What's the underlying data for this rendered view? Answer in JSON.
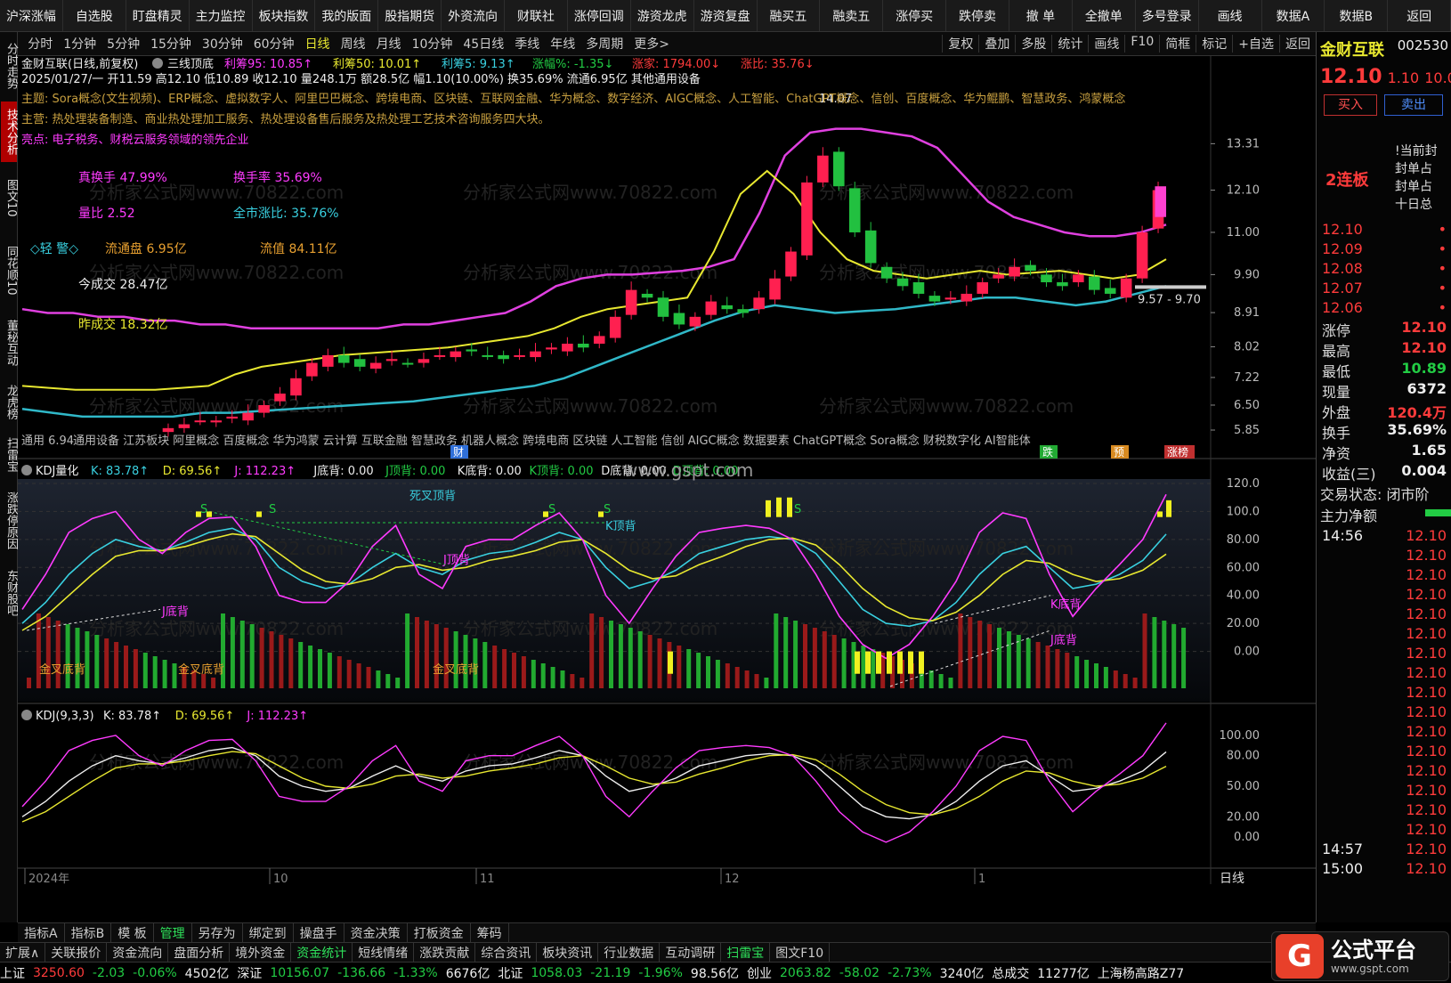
{
  "top_menu": [
    "沪深涨幅",
    "自选股",
    "盯盘精灵",
    "主力监控",
    "板块指数",
    "我的版面",
    "股指期货",
    "外资流向",
    "财联社",
    "涨停回调",
    "游资龙虎",
    "游资复盘",
    "融买五",
    "融卖五",
    "涨停买",
    "跌停卖",
    "撤 单",
    "全撤单",
    "多号登录",
    "画线",
    "数据A",
    "数据B",
    "返回"
  ],
  "period_tabs": [
    "分时",
    "1分钟",
    "5分钟",
    "15分钟",
    "30分钟",
    "60分钟",
    "日线",
    "周线",
    "月线",
    "10分钟",
    "45日线",
    "季线",
    "年线",
    "多周期",
    "更多>"
  ],
  "active_period": "日线",
  "tool_tabs": [
    "复权",
    "叠加",
    "多股",
    "统计",
    "画线",
    "F10",
    "简框",
    "标记",
    "+自选",
    "返回"
  ],
  "left_tabs": [
    "分时走势",
    "技术分析",
    "图文10",
    "同花顺10",
    "董秘互动",
    "龙虎榜",
    "扫雷宝",
    "涨跌停原因",
    "东财股吧"
  ],
  "active_left_tab": "技术分析",
  "header": {
    "stock_title": "金财互联(日线,前复权)",
    "pattern": "三线顶底",
    "chips": [
      {
        "text": "利筹95: 10.85↑",
        "color": "#ff3bff"
      },
      {
        "text": "利筹50: 10.01↑",
        "color": "#e8e830"
      },
      {
        "text": "利筹5: 9.13↑",
        "color": "#39d0e0"
      },
      {
        "text": "涨幅%: -1.35↓",
        "color": "#22cc44"
      },
      {
        "text": "涨家: 1794.00↓",
        "color": "#ff3b3b"
      },
      {
        "text": "涨比: 35.76↓",
        "color": "#ff3b3b"
      }
    ],
    "date_line": "2025/01/27/一 开11.59 高12.10 低10.89 收12.10 量248.1万 额28.5亿 幅1.10(10.00%) 换35.69% 流通6.95亿 其他通用设备",
    "theme": "主题: Sora概念(文生视频)、ERP概念、虚拟数字人、阿里巴巴概念、跨境电商、区块链、互联网金融、华为概念、数字经济、AIGC概念、人工智能、ChatGPT概念、信创、百度概念、华为鲲鹏、智慧政务、鸿蒙概念",
    "business": "主营: 热处理装备制造、商业热处理加工服务、热处理设备售后服务及热处理工艺技术咨询服务四大块。",
    "highlight": "亮点: 电子税务、财税云服务领域的领先企业"
  },
  "info_labels": [
    {
      "text": "真换手 47.99%",
      "color": "#ff3bff"
    },
    {
      "text": "换手率 35.69%",
      "color": "#ff3bff"
    },
    {
      "text": "量比 2.52",
      "color": "#ff3bff"
    },
    {
      "text": "全市涨比: 35.76%",
      "color": "#39d0e0"
    },
    {
      "text": "◇轻 警◇",
      "color": "#39d0e0"
    },
    {
      "text": "流通盘 6.95亿",
      "color": "#e8a030"
    },
    {
      "text": "流值 84.11亿",
      "color": "#e8a030"
    },
    {
      "text": "今成交 28.47亿",
      "color": "#eeeeee"
    },
    {
      "text": "昨成交 18.32亿",
      "color": "#e8e830"
    }
  ],
  "concept_bar": "通用设备 江苏板块 阿里概念 百度概念 华为鸿蒙 云计算 互联金融 智慧政务 机器人概念 跨境电商 区块链 人工智能 信创 AIGC概念 数据要素 ChatGPT概念 Sora概念 财税数字化 AI智能体",
  "concept_prefix": "通用 6.94",
  "main_price_ticks": [
    "13.31",
    "12.10",
    "11.00",
    "9.90",
    "8.91",
    "8.02",
    "7.22",
    "6.50",
    "5.85"
  ],
  "price_annotations": {
    "high": "14.07",
    "range": "9.57 - 9.70"
  },
  "badges": [
    {
      "text": "财",
      "color": "#2f6fd8"
    },
    {
      "text": "跌",
      "color": "#22aa33"
    },
    {
      "text": "预",
      "color": "#d88a20"
    },
    {
      "text": "涨榜",
      "color": "#c03030"
    }
  ],
  "kdj_quant": {
    "title": "KDJ量化",
    "values": [
      {
        "text": "K: 83.78↑",
        "color": "#39d0e0"
      },
      {
        "text": "D: 69.56↑",
        "color": "#e8e830"
      },
      {
        "text": "J: 112.23↑",
        "color": "#ff3bff"
      },
      {
        "text": "J底背: 0.00",
        "color": "#eeeeee"
      },
      {
        "text": "J顶背: 0.00",
        "color": "#22cc44"
      },
      {
        "text": "K底背: 0.00",
        "color": "#eeeeee"
      },
      {
        "text": "K顶背: 0.00",
        "color": "#22cc44"
      },
      {
        "text": "D底背: 0.00",
        "color": "#eeeeee"
      },
      {
        "text": "D顶背: 0.00",
        "color": "#22cc44"
      }
    ],
    "ticks": [
      "120.0",
      "100.0",
      "80.00",
      "60.00",
      "40.00",
      "20.00",
      "0.00"
    ],
    "annotations": [
      "死叉顶背",
      "J顶背",
      "K顶背",
      "J底背",
      "K底背",
      "J底背",
      "金叉底背",
      "金叉底背",
      "金叉底背",
      "S",
      "S",
      "S",
      "S",
      "S"
    ]
  },
  "kdj933": {
    "title": "KDJ(9,3,3)",
    "values": [
      {
        "text": "K: 83.78↑",
        "color": "#eeeeee"
      },
      {
        "text": "D: 69.56↑",
        "color": "#e8e830"
      },
      {
        "text": "J: 112.23↑",
        "color": "#ff3bff"
      }
    ],
    "ticks": [
      "100.00",
      "80.00",
      "50.00",
      "20.00",
      "0.00"
    ]
  },
  "date_axis": [
    "2024年",
    "10",
    "11",
    "12",
    "1"
  ],
  "date_axis_label": "日线",
  "watermark": "www.gspt.com",
  "watermark2": "分析家公式网www.70822.com",
  "right_panel": {
    "name": "金财互联",
    "code": "002530",
    "price": "12.10",
    "change": "1.10",
    "pct": "10.0",
    "buy": "买入",
    "sell": "卖出",
    "board": "2连板",
    "seal_labels": [
      "!当前封",
      "封单占",
      "封单占",
      "十日总"
    ],
    "order_prices": [
      "12.10",
      "12.09",
      "12.08",
      "12.07",
      "12.06"
    ],
    "stats": [
      {
        "label": "涨停",
        "value": "12.10",
        "color": "#ff3b3b"
      },
      {
        "label": "最高",
        "value": "12.10",
        "color": "#ff3b3b"
      },
      {
        "label": "最低",
        "value": "10.89",
        "color": "#22cc44"
      },
      {
        "label": "现量",
        "value": "6372",
        "color": "#eeeeee"
      },
      {
        "label": "外盘",
        "value": "120.4万",
        "color": "#ff3b3b"
      },
      {
        "label": "换手",
        "value": "35.69%",
        "color": "#eeeeee"
      },
      {
        "label": "净资",
        "value": "1.65",
        "color": "#eeeeee"
      },
      {
        "label": "收益(三)",
        "value": "0.004",
        "color": "#eeeeee"
      }
    ],
    "trade_state": "交易状态: 闭市阶",
    "main_flow": "主力净额",
    "tick_time_1": "14:56",
    "tick_time_2": "14:57",
    "tick_time_3": "15:00",
    "tick_price": "12.10"
  },
  "bottom_tabs_1": [
    "指标A",
    "指标B",
    "模 板",
    "管理",
    "另存为",
    "绑定到",
    "操盘手",
    "资金决策",
    "打板资金",
    "筹码"
  ],
  "active_bottom_tab": "管理",
  "bottom_tabs_2": [
    "扩展∧",
    "关联报价",
    "资金流向",
    "盘面分析",
    "境外资金",
    "资金统计",
    "短线情绪",
    "涨跌贡献",
    "综合资讯",
    "板块资讯",
    "行业数据",
    "互动调研",
    "扫雷宝",
    "图文F10"
  ],
  "status": [
    {
      "text": "上证",
      "color": "#eeeeee"
    },
    {
      "text": "3250.60",
      "color": "#ff3b3b"
    },
    {
      "text": "-2.03",
      "color": "#22cc44"
    },
    {
      "text": "-0.06%",
      "color": "#22cc44"
    },
    {
      "text": "4502亿",
      "color": "#eeeeee"
    },
    {
      "text": "深证",
      "color": "#eeeeee"
    },
    {
      "text": "10156.07",
      "color": "#22cc44"
    },
    {
      "text": "-136.66",
      "color": "#22cc44"
    },
    {
      "text": "-1.33%",
      "color": "#22cc44"
    },
    {
      "text": "6676亿",
      "color": "#eeeeee"
    },
    {
      "text": "北证",
      "color": "#eeeeee"
    },
    {
      "text": "1058.03",
      "color": "#22cc44"
    },
    {
      "text": "-21.19",
      "color": "#22cc44"
    },
    {
      "text": "-1.96%",
      "color": "#22cc44"
    },
    {
      "text": "98.56亿",
      "color": "#eeeeee"
    },
    {
      "text": "创业",
      "color": "#eeeeee"
    },
    {
      "text": "2063.82",
      "color": "#22cc44"
    },
    {
      "text": "-58.02",
      "color": "#22cc44"
    },
    {
      "text": "-2.73%",
      "color": "#22cc44"
    },
    {
      "text": "3240亿",
      "color": "#eeeeee"
    },
    {
      "text": "总成交",
      "color": "#eeeeee"
    },
    {
      "text": "11277亿",
      "color": "#eeeeee"
    },
    {
      "text": "上海杨高路Z77",
      "color": "#eeeeee"
    }
  ],
  "logo": {
    "mark": "G",
    "title": "公式平台",
    "url": "www.gspt.com"
  },
  "chart_data": {
    "type": "line",
    "title": "金财互联(日线,前复权)",
    "series": [
      {
        "name": "K",
        "values": [
          20,
          35,
          55,
          70,
          80,
          75,
          72,
          78,
          85,
          88,
          80,
          60,
          50,
          45,
          48,
          60,
          70,
          60,
          55,
          65,
          70,
          72,
          78,
          85,
          80,
          60,
          45,
          50,
          58,
          70,
          75,
          80,
          82,
          80,
          70,
          50,
          30,
          20,
          18,
          22,
          35,
          55,
          70,
          75,
          60,
          45,
          48,
          55,
          65,
          83.78
        ]
      },
      {
        "name": "D",
        "values": [
          15,
          25,
          40,
          55,
          68,
          72,
          72,
          75,
          80,
          84,
          82,
          70,
          58,
          50,
          48,
          52,
          60,
          62,
          58,
          60,
          65,
          68,
          72,
          78,
          80,
          70,
          58,
          52,
          54,
          62,
          68,
          75,
          80,
          81,
          76,
          62,
          45,
          32,
          24,
          22,
          28,
          40,
          55,
          65,
          63,
          55,
          50,
          52,
          58,
          69.56
        ]
      },
      {
        "name": "J",
        "values": [
          30,
          55,
          85,
          95,
          100,
          80,
          70,
          85,
          95,
          96,
          75,
          40,
          35,
          35,
          50,
          75,
          90,
          55,
          45,
          75,
          80,
          80,
          90,
          99,
          80,
          40,
          20,
          45,
          68,
          85,
          88,
          90,
          88,
          80,
          55,
          25,
          5,
          -5,
          5,
          25,
          50,
          85,
          99,
          95,
          55,
          25,
          45,
          62,
          80,
          112.23
        ]
      }
    ],
    "ylim": [
      -20,
      120
    ],
    "price_series": {
      "name": "close",
      "values": [
        5.9,
        6.0,
        6.1,
        6.1,
        6.2,
        6.3,
        6.5,
        6.8,
        7.2,
        7.6,
        7.8,
        7.6,
        7.5,
        7.6,
        7.7,
        7.6,
        7.7,
        7.8,
        7.9,
        7.9,
        7.8,
        7.7,
        7.8,
        7.9,
        8.0,
        8.1,
        8.0,
        8.3,
        8.8,
        9.5,
        9.3,
        8.8,
        8.6,
        8.8,
        9.2,
        9.0,
        8.9,
        9.3,
        9.8,
        10.5,
        12.3,
        13.0,
        12.2,
        11.0,
        10.2,
        9.8,
        9.6,
        9.4,
        9.2,
        9.3,
        9.4,
        9.7,
        9.9,
        10.1,
        10.0,
        9.7,
        9.6,
        9.9,
        9.5,
        9.4,
        9.8,
        11.0,
        12.1
      ],
      "ylim": [
        5.85,
        14.2
      ]
    },
    "ma_upper": [
      9.0,
      8.9,
      8.9,
      8.8,
      8.8,
      8.7,
      8.7,
      8.6,
      8.6,
      8.5,
      8.5,
      8.5,
      8.5,
      8.5,
      8.5,
      8.6,
      8.6,
      8.7,
      8.8,
      8.9,
      9.2,
      9.6,
      9.8,
      9.9,
      9.9,
      9.95,
      10.0,
      10.1,
      10.3,
      11.5,
      13.0,
      13.6,
      13.7,
      13.7,
      13.6,
      13.5,
      13.2,
      12.5,
      11.8,
      11.4,
      11.2,
      11.0,
      10.9,
      10.9,
      11.0,
      11.2
    ],
    "ma_mid": [
      7.0,
      6.95,
      6.9,
      6.9,
      6.9,
      6.9,
      6.95,
      7.0,
      7.3,
      7.5,
      7.6,
      7.7,
      7.8,
      7.85,
      7.9,
      7.95,
      8.0,
      8.1,
      8.2,
      8.3,
      8.5,
      8.8,
      9.0,
      9.1,
      9.2,
      9.3,
      10.5,
      12.0,
      12.6,
      12.0,
      11.0,
      10.3,
      10.0,
      9.9,
      9.8,
      9.9,
      10.0,
      9.9,
      9.95,
      10.0,
      9.9,
      9.8,
      9.9,
      10.3
    ],
    "ma_lower": [
      6.4,
      6.3,
      6.2,
      6.2,
      6.2,
      6.2,
      6.3,
      6.3,
      6.35,
      6.4,
      6.45,
      6.5,
      6.55,
      6.6,
      6.7,
      6.8,
      6.9,
      7.0,
      7.2,
      7.5,
      7.8,
      8.1,
      8.4,
      8.7,
      8.95,
      9.1,
      9.0,
      8.9,
      8.95,
      9.0,
      9.1,
      9.2,
      9.3,
      9.3,
      9.2,
      9.1,
      9.2,
      9.4,
      9.6
    ]
  }
}
